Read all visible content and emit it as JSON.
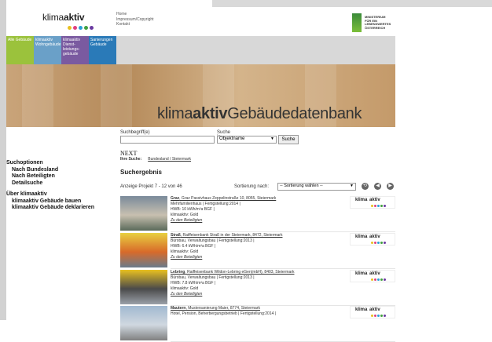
{
  "header": {
    "logo_thin": "klima",
    "logo_bold": "aktiv",
    "links": [
      "Home",
      "Impressum/Copyright",
      "Kontakt"
    ],
    "ministry_lines": [
      "MINISTERIUM",
      "FÜR EIN",
      "LEBENSWERTES",
      "ÖSTERREICH"
    ],
    "dot_colors": [
      "#e8c020",
      "#e04080",
      "#2aa0d8",
      "#40a040",
      "#6a3aa0"
    ]
  },
  "nav": {
    "tabs": [
      {
        "label": "Alle Gebäude",
        "color": "#9bc23c"
      },
      {
        "label": "klimaaktiv Wohngebäude",
        "color": "#6aa0c8"
      },
      {
        "label": "klimaaktiv Dienst-leistungs-gebäude",
        "color": "#7a5aa0"
      },
      {
        "label": "Sanierungen Gebäude",
        "color": "#2a7ab8"
      }
    ]
  },
  "banner": {
    "title_thin": "klima",
    "title_bold": "aktiv",
    "title_rest": "Gebäudedatenbank"
  },
  "search": {
    "label": "Suchbegriff(e)",
    "value": "",
    "in_label": "Suche in",
    "in_selected": "Objektname",
    "button": "Suche"
  },
  "sidebar": {
    "heading": "Suchoptionen",
    "options": [
      "Nach Bundesland",
      "Nach Beteiligten",
      "Detailsuche"
    ],
    "about_heading": "Über klimaaktiv",
    "about_links": [
      "klimaaktiv Gebäude bauen",
      "klimaaktiv Gebäude deklarieren"
    ]
  },
  "results": {
    "next": "NEXT",
    "ihre_suche_label": "Ihre Suche:",
    "ihre_suche_value": "Bundesland / Steiermark",
    "heading": "Suchergebnis",
    "count": "Anzeige Projekt 7 - 12 von 46",
    "sort_label": "Sortierung nach:",
    "sort_selected": "-- Sortierung wählen --",
    "pager": [
      "⟲",
      "◀",
      "▶"
    ],
    "items": [
      {
        "city": "Graz",
        "title_rest": ", Graz Passivhaus Zeppelinstraße 10, 8055, Steiermark",
        "type": "Mehrfamilienhaus | Fertigstellung:2014 |",
        "hwb": "HWB: 10 kWh/m²a BGF |",
        "status": "klimaaktiv: Gold",
        "link": "Zu den Beteiligten",
        "thumb": [
          "#7a8a9a",
          "#c8c0b0",
          "#5a6a5a"
        ]
      },
      {
        "city": "Straß",
        "title_rest": ", Raiffeisenbank Straß in der Steiermark, 8472, Steiermark",
        "type": "Bürobau, Verwaltungsbau | Fertigstellung:2013 |",
        "hwb": "HWB: 6.4 kWh/m²a BGF |",
        "status": "klimaaktiv: Gold",
        "link": "Zu den Beteiligten",
        "thumb": [
          "#e8d040",
          "#d86a2a",
          "#6a7a8a"
        ]
      },
      {
        "city": "Lebring",
        "title_rest": ", Raiffeisenbank Wildon-Lebring eGen(mbH), 8403, Steiermark",
        "type": "Bürobau, Verwaltungsbau | Fertigstellung:2013 |",
        "hwb": "HWB: 7.8 kWh/m²a BGF |",
        "status": "klimaaktiv: Gold",
        "link": "Zu den Beteiligten",
        "thumb": [
          "#e8c020",
          "#4a4a4a",
          "#9aa0a8"
        ]
      },
      {
        "city": "Mautern",
        "title_rest": ", Mustersanierung Maier, 8774, Steiermark",
        "type": "Hotel, Pension, Beherbergungsbetrieb | Fertigstellung:2014 |",
        "hwb": "",
        "status": "",
        "link": "",
        "thumb": [
          "#a0b8d0",
          "#d0d8e0",
          "#808080"
        ]
      }
    ]
  }
}
